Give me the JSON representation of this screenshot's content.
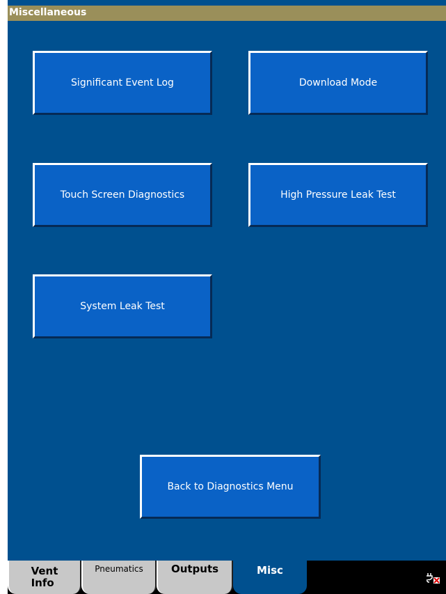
{
  "window": {
    "title": "Miscellaneous"
  },
  "buttons": {
    "significant_event_log": "Significant Event Log",
    "download_mode": "Download Mode",
    "touch_screen_diagnostics": "Touch Screen Diagnostics",
    "high_pressure_leak_test": "High Pressure Leak Test",
    "system_leak_test": "System Leak Test",
    "back_to_diagnostics_menu": "Back to Diagnostics Menu"
  },
  "tabs": [
    {
      "label": "Vent\nInfo",
      "active": false
    },
    {
      "label": "Pneumatics",
      "active": false
    },
    {
      "label": "Outputs",
      "active": false
    },
    {
      "label": "Misc",
      "active": true
    }
  ],
  "status": {
    "icon": "power-plug-disconnected-icon"
  },
  "colors": {
    "background": "#00508f",
    "title_bar": "#9a8f5a",
    "button": "#0a62c6",
    "tab_inactive": "#c8c8c8",
    "tab_bar": "#000000"
  }
}
